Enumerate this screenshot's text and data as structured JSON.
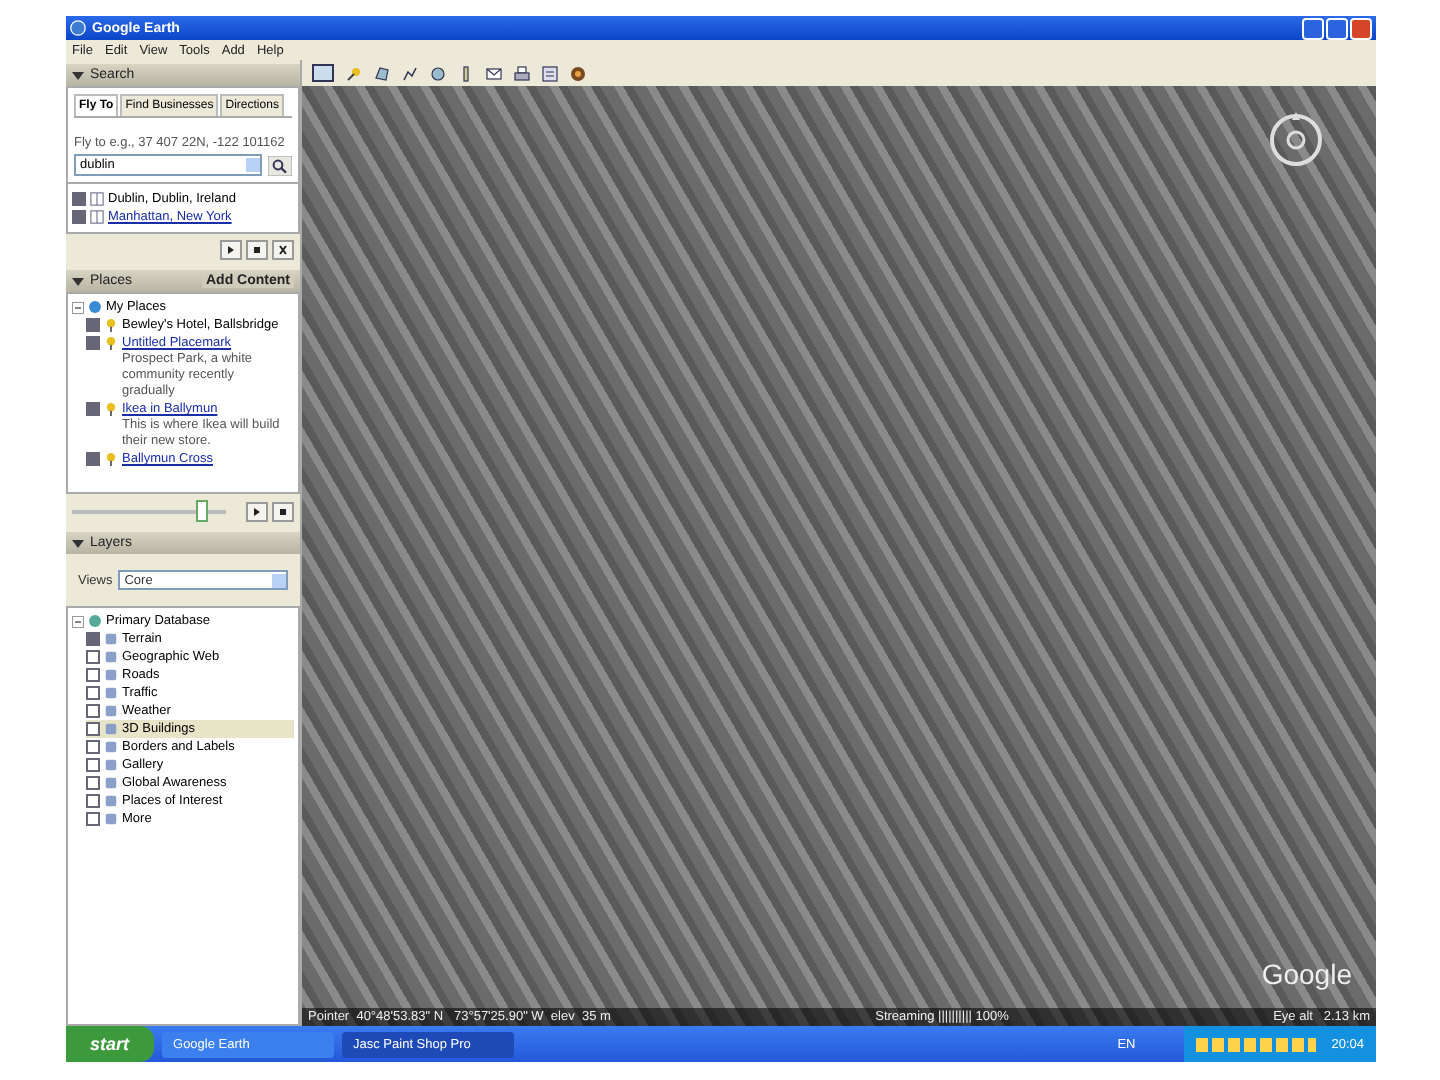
{
  "window": {
    "title": "Google Earth"
  },
  "menu": [
    "File",
    "Edit",
    "View",
    "Tools",
    "Add",
    "Help"
  ],
  "search": {
    "title": "Search",
    "tabs": [
      {
        "label": "Fly To",
        "selected": true
      },
      {
        "label": "Find Businesses",
        "selected": false
      },
      {
        "label": "Directions",
        "selected": false
      }
    ],
    "hint": "Fly to e.g., 37 407 22N, -122 101162",
    "query": "dublin",
    "results": [
      {
        "label": "Dublin, Dublin, Ireland",
        "checked": true,
        "link": false
      },
      {
        "label": "Manhattan, New York",
        "checked": true,
        "link": true
      }
    ]
  },
  "places": {
    "title": "Places",
    "add_content": "Add Content",
    "root": {
      "label": "My Places",
      "expanded": true,
      "children": [
        {
          "label": "Bewley's Hotel, Ballsbridge",
          "checked": true,
          "link": false
        },
        {
          "label": "Untitled Placemark",
          "checked": true,
          "link": true,
          "description": "Prospect Park, a white community recently gradually"
        },
        {
          "label": "Ikea in Ballymun",
          "checked": true,
          "link": true,
          "description": "This is where Ikea will build their new store."
        },
        {
          "label": "Ballymun Cross",
          "checked": true,
          "link": true
        }
      ]
    },
    "level": 0.85
  },
  "layers": {
    "title": "Layers",
    "views_label": "Views",
    "view": "Core",
    "root": {
      "label": "Primary Database",
      "expanded": true,
      "children": [
        {
          "label": "Terrain",
          "checked": true,
          "selected": false
        },
        {
          "label": "Geographic Web",
          "checked": false,
          "selected": false
        },
        {
          "label": "Roads",
          "checked": false,
          "selected": false
        },
        {
          "label": "Traffic",
          "checked": false,
          "selected": false
        },
        {
          "label": "Weather",
          "checked": false,
          "selected": false
        },
        {
          "label": "3D Buildings",
          "checked": false,
          "selected": true
        },
        {
          "label": "Borders and Labels",
          "checked": false,
          "selected": false
        },
        {
          "label": "Gallery",
          "checked": false,
          "selected": false
        },
        {
          "label": "Global Awareness",
          "checked": false,
          "selected": false
        },
        {
          "label": "Places of Interest",
          "checked": false,
          "selected": false
        },
        {
          "label": "More",
          "checked": false,
          "selected": false
        }
      ]
    }
  },
  "map": {
    "pointer": "Pointer  40°48'53.83\" N   73°57'25.90\" W  elev  35 m",
    "streaming": "Streaming |||||||||| 100%",
    "eye_alt": "Eye alt   2.13 km",
    "logo": "Google"
  },
  "taskbar": {
    "start": "start",
    "tasks": [
      {
        "label": "Google Earth",
        "selected": false
      },
      {
        "label": "Jasc Paint Shop Pro",
        "selected": true
      }
    ],
    "language": "EN",
    "clock": "20:04"
  }
}
